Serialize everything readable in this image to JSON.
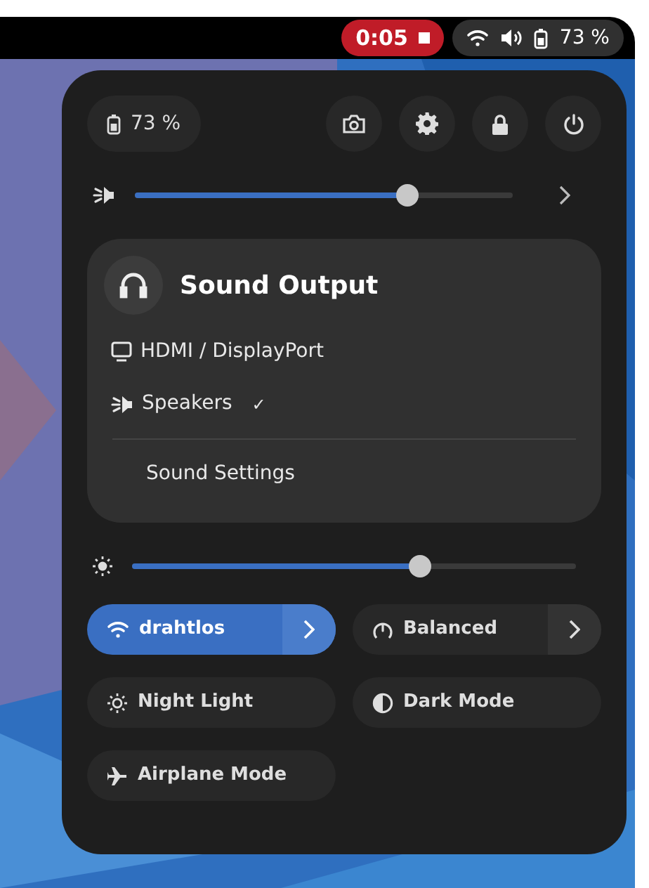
{
  "top_bar": {
    "recording": {
      "time": "0:05"
    },
    "status": {
      "battery": "73 %"
    }
  },
  "panel": {
    "battery": "73 %",
    "volume": {
      "level": 0.72
    },
    "sound_output": {
      "title": "Sound Output",
      "check": "✓",
      "devices": [
        {
          "label": "HDMI / DisplayPort",
          "kind": "monitor",
          "selected": false
        },
        {
          "label": "Speakers",
          "kind": "speaker",
          "selected": true
        }
      ],
      "settings": "Sound Settings"
    },
    "brightness": {
      "level": 0.65
    },
    "toggles": [
      {
        "label": "drahtlos",
        "kind": "wifi",
        "on": true,
        "arrow": true
      },
      {
        "label": "Balanced",
        "kind": "power",
        "on": false,
        "arrow": true
      },
      {
        "label": "Night Light",
        "kind": "night",
        "on": false,
        "arrow": false
      },
      {
        "label": "Dark Mode",
        "kind": "dark",
        "on": false,
        "arrow": false
      },
      {
        "label": "Airplane Mode",
        "kind": "airplane",
        "on": false,
        "arrow": false
      }
    ]
  }
}
